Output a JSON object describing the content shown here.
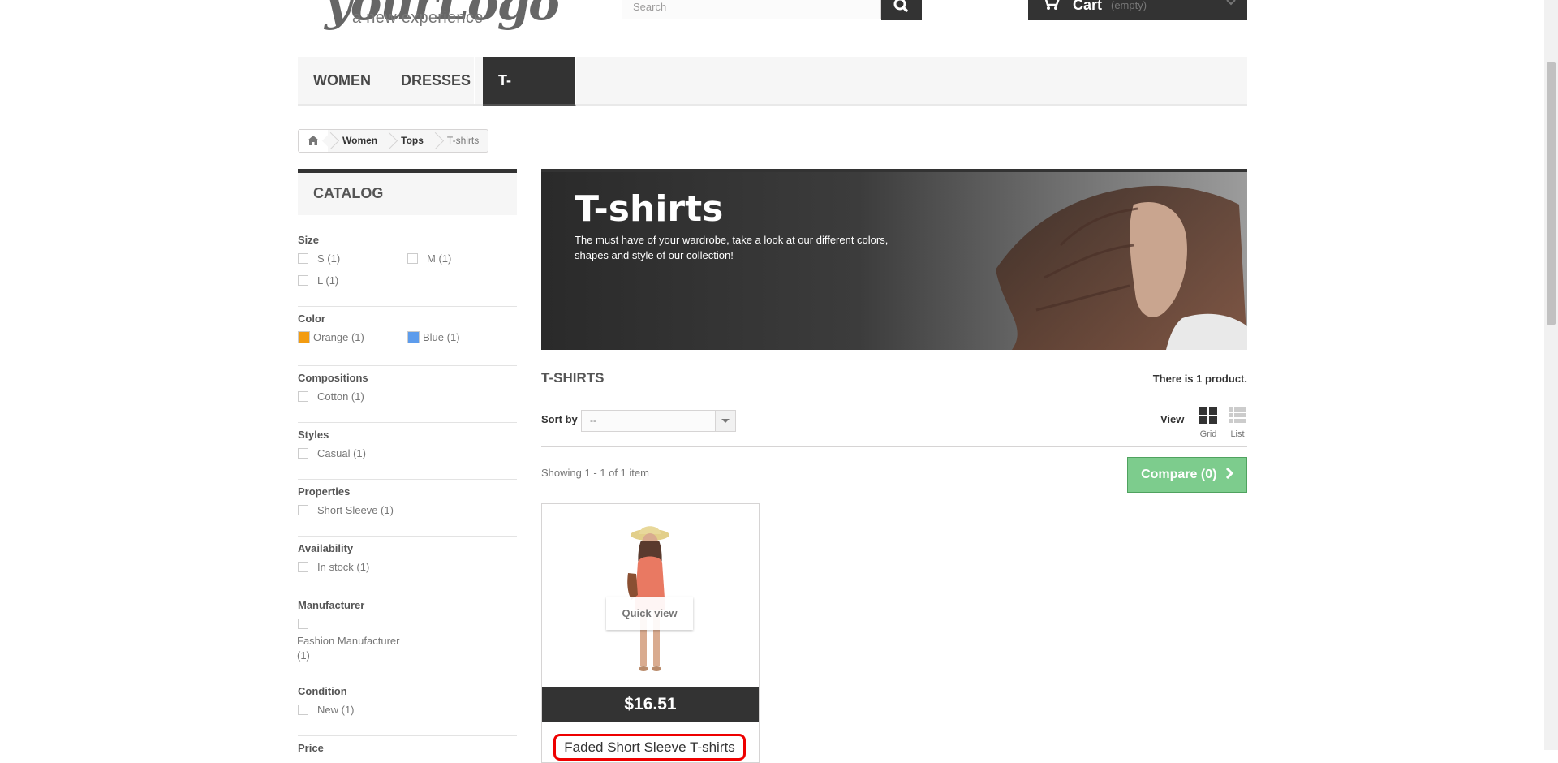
{
  "header": {
    "logo_text": "yourLogo",
    "logo_tagline": "a new experience",
    "search_placeholder": "Search",
    "cart_label": "Cart",
    "cart_status": "(empty)"
  },
  "menu": [
    "Women",
    "Dresses",
    "T-shirts"
  ],
  "breadcrumb": [
    "Women",
    "Tops",
    "T-shirts"
  ],
  "sidebar": {
    "title": "Catalog",
    "size": {
      "title": "Size",
      "options": [
        "S (1)",
        "M (1)",
        "L (1)"
      ]
    },
    "color": {
      "title": "Color",
      "options": [
        {
          "label": "Orange (1)",
          "color": "#F39C11"
        },
        {
          "label": "Blue (1)",
          "color": "#5D9CEC"
        }
      ]
    },
    "compositions": {
      "title": "Compositions",
      "options": [
        "Cotton (1)"
      ]
    },
    "styles": {
      "title": "Styles",
      "options": [
        "Casual (1)"
      ]
    },
    "properties": {
      "title": "Properties",
      "options": [
        "Short Sleeve (1)"
      ]
    },
    "availability": {
      "title": "Availability",
      "options": [
        "In stock (1)"
      ]
    },
    "manufacturer": {
      "title": "Manufacturer",
      "options": [
        "Fashion Manufacturer (1)"
      ]
    },
    "condition": {
      "title": "Condition",
      "options": [
        "New (1)"
      ]
    },
    "price": {
      "title": "Price"
    }
  },
  "banner": {
    "title": "T-shirts",
    "description": "The must have of your wardrobe, take a look at our different colors, shapes and style of our collection!"
  },
  "category": {
    "name": "T-shirts",
    "product_count": "There is 1 product.",
    "sort_label": "Sort by",
    "sort_value": "--",
    "view_label": "View",
    "view_grid": "Grid",
    "view_list": "List",
    "showing": "Showing 1 - 1 of 1 item",
    "compare": "Compare (0)"
  },
  "product": {
    "quick_view": "Quick view",
    "price": "$16.51",
    "name": "Faded Short Sleeve T-shirts"
  },
  "colors": {
    "accent_dark": "#333333",
    "compare_green": "#7DCC8D",
    "highlight_red": "#EE0000"
  }
}
